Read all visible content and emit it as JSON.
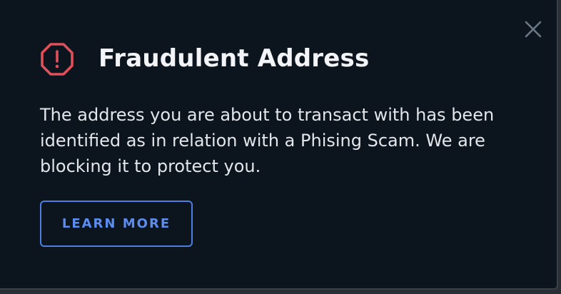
{
  "dialog": {
    "title": "Fraudulent Address",
    "message": "The address you are about to transact with has been identified as in relation with a Phising Scam. We are blocking it to protect you.",
    "learn_more_label": "LEARN MORE",
    "icons": {
      "warning": "octagon-exclamation-icon",
      "close": "close-icon"
    },
    "colors": {
      "background": "#0c141d",
      "warning": "#e0505a",
      "accent": "#5b8cf0",
      "title_text": "#f2f4f7",
      "body_text": "#e3e6ea"
    }
  }
}
